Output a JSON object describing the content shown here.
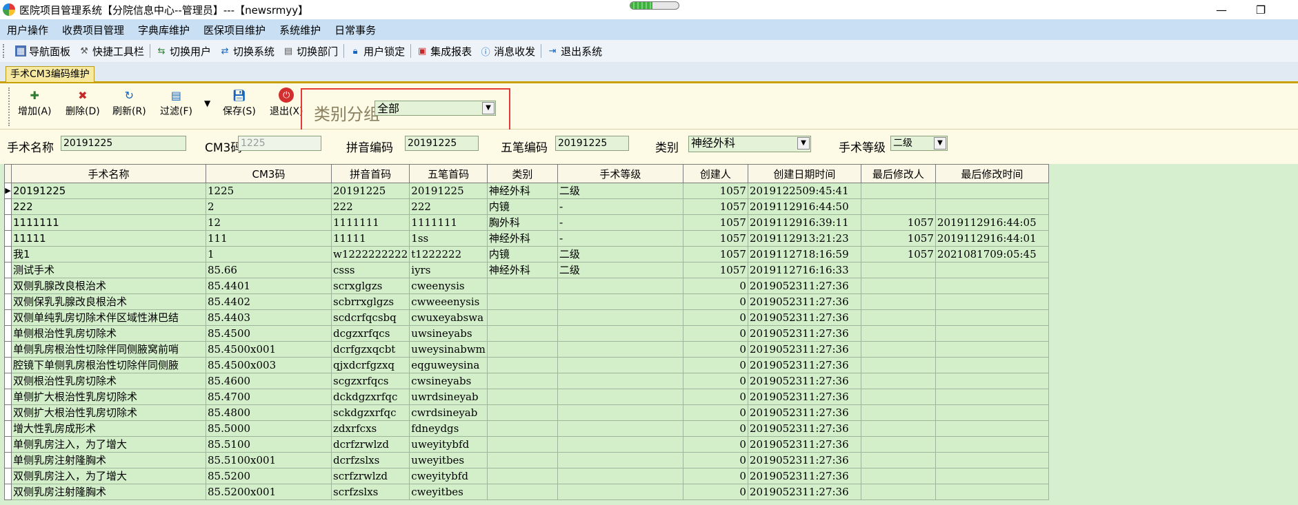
{
  "window": {
    "title": "医院项目管理系统【分院信息中心--管理员】---【newsrmyy】",
    "progress": 0.45,
    "minimize_glyph": "—",
    "maximize_glyph": "❐"
  },
  "menubar": [
    "用户操作",
    "收费项目管理",
    "字典库维护",
    "医保项目维护",
    "系统维护",
    "日常事务"
  ],
  "toolbar": [
    {
      "label": "导航面板",
      "icon": "nav-panel-icon"
    },
    {
      "label": "快捷工具栏",
      "icon": "quick-toolbar-icon"
    },
    {
      "label": "切换用户",
      "icon": "switch-user-icon"
    },
    {
      "label": "切换系统",
      "icon": "switch-system-icon"
    },
    {
      "label": "切换部门",
      "icon": "switch-dept-icon"
    },
    {
      "label": "用户锁定",
      "icon": "user-lock-icon"
    },
    {
      "label": "集成报表",
      "icon": "report-icon"
    },
    {
      "label": "消息收发",
      "icon": "message-icon"
    },
    {
      "label": "退出系统",
      "icon": "exit-system-icon"
    }
  ],
  "tab": {
    "label": "手术CM3编码维护"
  },
  "actions": [
    {
      "label": "增加(A)",
      "icon": "add-icon"
    },
    {
      "label": "删除(D)",
      "icon": "delete-icon"
    },
    {
      "label": "刷新(R)",
      "icon": "refresh-icon"
    },
    {
      "label": "过滤(F)",
      "icon": "filter-icon"
    },
    {
      "label": "保存(S)",
      "icon": "save-icon"
    },
    {
      "label": "退出(X)",
      "icon": "exit-icon"
    }
  ],
  "category_filter": {
    "label": "类别分组",
    "value": "全部"
  },
  "form": {
    "name_label": "手术名称",
    "name_value": "20191225",
    "cm3_label": "CM3码",
    "cm3_value": "1225",
    "pinyin_label": "拼音编码",
    "pinyin_value": "20191225",
    "wubi_label": "五笔编码",
    "wubi_value": "20191225",
    "category_label": "类别",
    "category_value": "神经外科",
    "level_label": "手术等级",
    "level_value": "二级"
  },
  "grid": {
    "columns": [
      "手术名称",
      "CM3码",
      "拼音首码",
      "五笔首码",
      "类别",
      "手术等级",
      "创建人",
      "创建日期时间",
      "最后修改人",
      "最后修改时间"
    ],
    "rows": [
      [
        "20191225",
        "1225",
        "20191225",
        "20191225",
        "神经外科",
        "二级",
        "1057",
        "2019122509:45:41",
        "",
        ""
      ],
      [
        "222",
        "2",
        "222",
        "222",
        "内镜",
        "-",
        "1057",
        "2019112916:44:50",
        "",
        ""
      ],
      [
        "1111111",
        "12",
        "1111111",
        "1111111",
        "胸外科",
        "-",
        "1057",
        "2019112916:39:11",
        "1057",
        "2019112916:44:05"
      ],
      [
        "11111",
        "111",
        "11111",
        "1ss",
        "神经外科",
        "-",
        "1057",
        "2019112913:21:23",
        "1057",
        "2019112916:44:01"
      ],
      [
        "我1",
        "1",
        "w1222222222",
        "t1222222",
        "内镜",
        "二级",
        "1057",
        "2019112718:16:59",
        "1057",
        "2021081709:05:45"
      ],
      [
        "测试手术",
        "85.66",
        "csss",
        "iyrs",
        "神经外科",
        "二级",
        "1057",
        "2019112716:16:33",
        "",
        ""
      ],
      [
        "双侧乳腺改良根治术",
        "85.4401",
        "scrxglgzs",
        "cweenysis",
        "",
        "",
        "0",
        "2019052311:27:36",
        "",
        ""
      ],
      [
        "双侧保乳乳腺改良根治术",
        "85.4402",
        "scbrrxglgzs",
        "cwweeenysis",
        "",
        "",
        "0",
        "2019052311:27:36",
        "",
        ""
      ],
      [
        "双侧单纯乳房切除术伴区域性淋巴结",
        "85.4403",
        "scdcrfqcsbq",
        "cwuxeyabswa",
        "",
        "",
        "0",
        "2019052311:27:36",
        "",
        ""
      ],
      [
        "单侧根治性乳房切除术",
        "85.4500",
        "dcgzxrfqcs",
        "uwsineyabs",
        "",
        "",
        "0",
        "2019052311:27:36",
        "",
        ""
      ],
      [
        "单侧乳房根治性切除伴同侧腋窝前哨",
        "85.4500x001",
        "dcrfgzxqcbt",
        "uweysinabwm",
        "",
        "",
        "0",
        "2019052311:27:36",
        "",
        ""
      ],
      [
        "腔镜下单侧乳房根治性切除伴同侧腋",
        "85.4500x003",
        "qjxdcrfgzxq",
        "eqguweysina",
        "",
        "",
        "0",
        "2019052311:27:36",
        "",
        ""
      ],
      [
        "双侧根治性乳房切除术",
        "85.4600",
        "scgzxrfqcs",
        "cwsineyabs",
        "",
        "",
        "0",
        "2019052311:27:36",
        "",
        ""
      ],
      [
        "单侧扩大根治性乳房切除术",
        "85.4700",
        "dckdgzxrfqc",
        "uwrdsineyab",
        "",
        "",
        "0",
        "2019052311:27:36",
        "",
        ""
      ],
      [
        "双侧扩大根治性乳房切除术",
        "85.4800",
        "sckdgzxrfqc",
        "cwrdsineyab",
        "",
        "",
        "0",
        "2019052311:27:36",
        "",
        ""
      ],
      [
        "增大性乳房成形术",
        "85.5000",
        "zdxrfcxs",
        "fdneydgs",
        "",
        "",
        "0",
        "2019052311:27:36",
        "",
        ""
      ],
      [
        "单侧乳房注入，为了增大",
        "85.5100",
        "dcrfzrwlzd",
        "uweyitybfd",
        "",
        "",
        "0",
        "2019052311:27:36",
        "",
        ""
      ],
      [
        "单侧乳房注射隆胸术",
        "85.5100x001",
        "dcrfzslxs",
        "uweyitbes",
        "",
        "",
        "0",
        "2019052311:27:36",
        "",
        ""
      ],
      [
        "双侧乳房注入，为了增大",
        "85.5200",
        "scrfzrwlzd",
        "cweyitybfd",
        "",
        "",
        "0",
        "2019052311:27:36",
        "",
        ""
      ],
      [
        "双侧乳房注射隆胸术",
        "85.5200x001",
        "scrfzslxs",
        "cweyitbes",
        "",
        "",
        "0",
        "2019052311:27:36",
        "",
        ""
      ]
    ]
  }
}
